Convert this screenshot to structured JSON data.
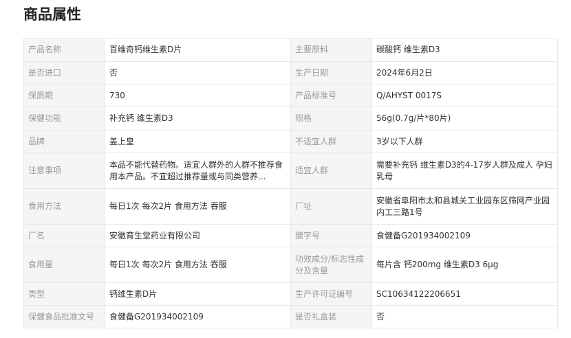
{
  "section": {
    "title": "商品属性"
  },
  "rows": [
    {
      "left": {
        "label": "产品名称",
        "value": "百维奇钙维生素D片"
      },
      "right": {
        "label": "主要原料",
        "value": "碳酸钙 维生素D3"
      }
    },
    {
      "left": {
        "label": "是否进口",
        "value": "否"
      },
      "right": {
        "label": "生产日期",
        "value": "2024年6月2日"
      }
    },
    {
      "left": {
        "label": "保质期",
        "value": "730"
      },
      "right": {
        "label": "产品标准号",
        "value": "Q/AHYST 0017S"
      }
    },
    {
      "left": {
        "label": "保健功能",
        "value": "补充钙 维生素D3"
      },
      "right": {
        "label": "规格",
        "value": "56g(0.7g/片*80片)"
      }
    },
    {
      "left": {
        "label": "品牌",
        "value": "盖上皇"
      },
      "right": {
        "label": "不适宜人群",
        "value": "3岁以下人群"
      }
    },
    {
      "left": {
        "label": "注意事项",
        "value": "本品不能代替药物。适宜人群外的人群不推荐食用本产品。不宜超过推荐量或与同类营养..."
      },
      "right": {
        "label": "适宜人群",
        "value": "需要补充钙 维生素D3的4-17岁人群及成人 孕妇 乳母"
      }
    },
    {
      "left": {
        "label": "食用方法",
        "value": "每日1次 每次2片 食用方法 吞服"
      },
      "right": {
        "label": "厂址",
        "value": "安徽省阜阳市太和县城关工业园东区筛网产业园内工三路1号"
      }
    },
    {
      "left": {
        "label": "厂名",
        "value": "安徽育生堂药业有限公司"
      },
      "right": {
        "label": "健字号",
        "value": "食健备G201934002109"
      }
    },
    {
      "left": {
        "label": "食用量",
        "value": "每日1次 每次2片 食用方法 吞服"
      },
      "right": {
        "label": "功效成分/标志性成分及含量",
        "value": "每片含 钙200mg 维生素D3 6μg"
      }
    },
    {
      "left": {
        "label": "类型",
        "value": "钙维生素D片"
      },
      "right": {
        "label": "生产许可证编号",
        "value": "SC10634122206651"
      }
    },
    {
      "left": {
        "label": "保健食品批准文号",
        "value": "食健备G201934002109"
      },
      "right": {
        "label": "是否礼盒装",
        "value": "否"
      }
    }
  ]
}
